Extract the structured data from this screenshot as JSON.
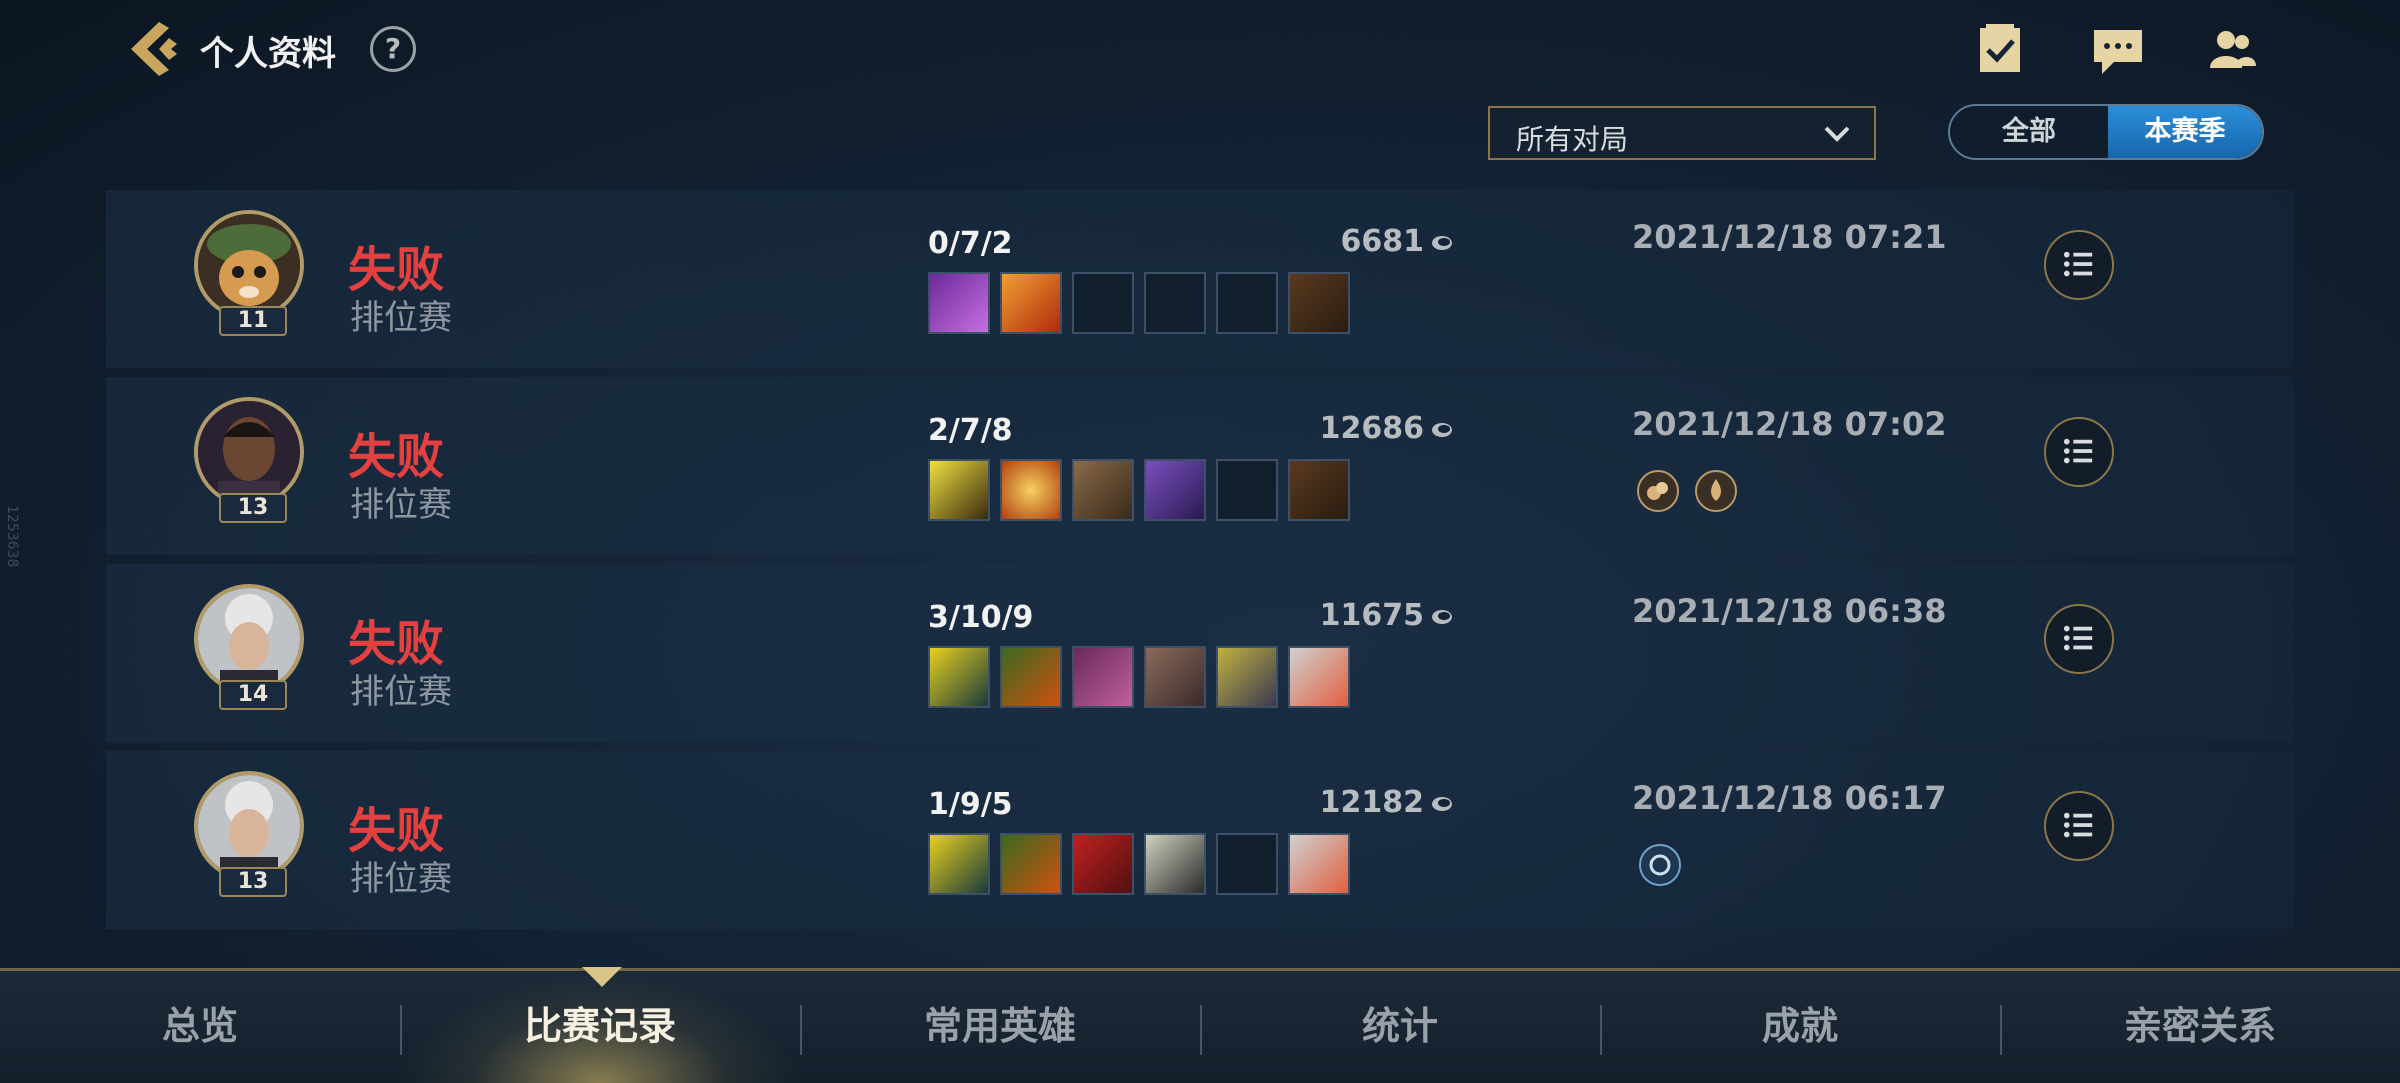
{
  "header": {
    "title": "个人资料",
    "help_label": "?"
  },
  "top_icons": [
    "missions-icon",
    "chat-icon",
    "friends-icon"
  ],
  "filter": {
    "selected": "所有对局"
  },
  "season_toggle": {
    "all_label": "全部",
    "season_label": "本赛季",
    "active": "本赛季"
  },
  "matches": [
    {
      "level": "11",
      "result": "失败",
      "mode": "排位赛",
      "kda": "0/7/2",
      "gold": "6681",
      "date": "2021/12/18 07:21",
      "items": [
        "purple-blade-item",
        "fire-sword-item",
        "empty",
        "empty",
        "empty",
        "boots-item"
      ],
      "badges": []
    },
    {
      "level": "13",
      "result": "失败",
      "mode": "排位赛",
      "kda": "2/7/8",
      "gold": "12686",
      "date": "2021/12/18 07:02",
      "items": [
        "lightning-blade-item",
        "sun-spear-item",
        "hammer-item",
        "purple-cloak-item",
        "empty",
        "boots-item"
      ],
      "badges": [
        "gold-coins-badge",
        "blood-drop-badge"
      ]
    },
    {
      "level": "14",
      "result": "失败",
      "mode": "排位赛",
      "kda": "3/10/9",
      "gold": "11675",
      "date": "2021/12/18 06:38",
      "items": [
        "triforce-item",
        "flame-bow-item",
        "gauntlet-item",
        "armor-item",
        "shuriken-item",
        "rainbow-feather-item"
      ],
      "badges": []
    },
    {
      "level": "13",
      "result": "失败",
      "mode": "排位赛",
      "kda": "1/9/5",
      "gold": "12182",
      "date": "2021/12/18 06:17",
      "items": [
        "triforce-item",
        "flame-bow-item",
        "crimson-claw-item",
        "longsword-item",
        "empty",
        "rainbow-feather-item"
      ],
      "badges": [
        "shield-badge"
      ]
    }
  ],
  "bottom_nav": {
    "tabs": [
      "总览",
      "比赛记录",
      "常用英雄",
      "统计",
      "成就",
      "亲密关系"
    ],
    "active": "比赛记录"
  },
  "side_text": "1253638",
  "colors": {
    "loss_red": "#e34040",
    "gold_border": "#8a7649",
    "season_blue": "#1f7cc6"
  }
}
